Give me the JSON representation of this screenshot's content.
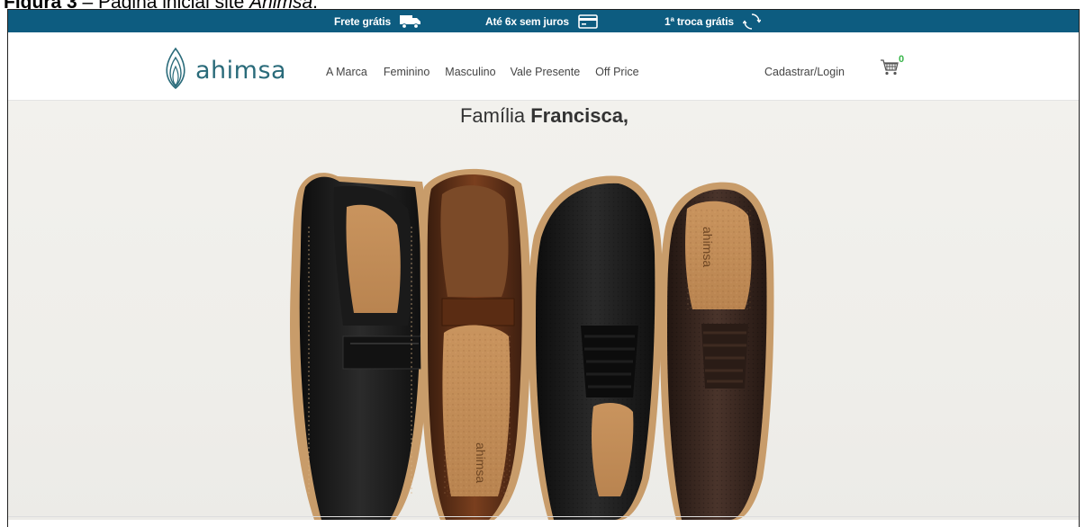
{
  "caption": {
    "prefix": "Figura 3",
    "sep": " – Página inicial site ",
    "brand": "Ahimsa",
    "end": "."
  },
  "topbar": {
    "bg": "#0d5c80",
    "promos": [
      {
        "label": "Frete grátis",
        "icon": "truck-icon"
      },
      {
        "label": "Até 6x sem juros",
        "icon": "credit-card-icon"
      },
      {
        "label": "1ª troca grátis",
        "icon": "exchange-icon"
      }
    ]
  },
  "header": {
    "logo_text": "ahimsa",
    "nav": [
      "A Marca",
      "Feminino",
      "Masculino",
      "Vale Presente",
      "Off Price"
    ],
    "login": "Cadastrar/Login",
    "cart_count": "0",
    "cart_count_color": "#39b54a"
  },
  "hero": {
    "title_regular": "Família ",
    "title_bold": "Francisca,",
    "insole_brand": "ahimsa"
  }
}
